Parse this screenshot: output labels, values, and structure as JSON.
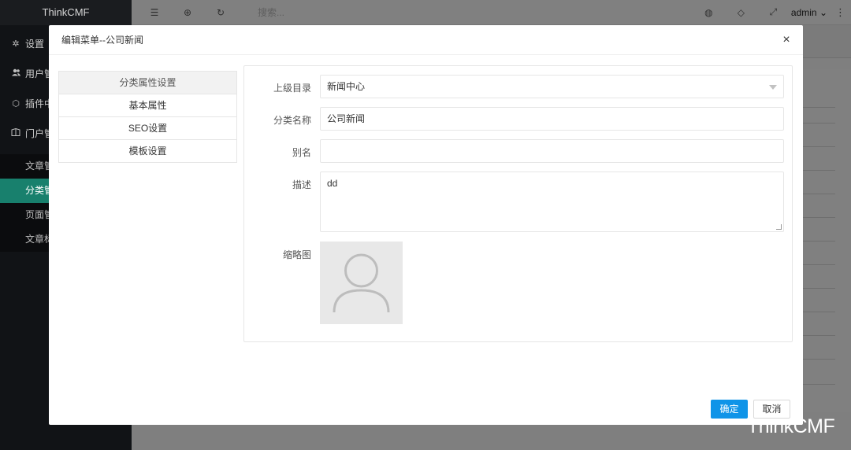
{
  "sidebar": {
    "logo": "ThinkCMF",
    "items": [
      {
        "icon": "gear-icon",
        "glyph": "✲",
        "label": "设置"
      },
      {
        "icon": "users-icon",
        "glyph": "👥",
        "label": "用户管"
      },
      {
        "icon": "plugin-icon",
        "glyph": "⬡",
        "label": "插件中"
      },
      {
        "icon": "portal-icon",
        "glyph": "⌂",
        "label": "门户管"
      }
    ],
    "subitems": [
      {
        "label": "文章管"
      },
      {
        "label": "分类管",
        "active": true
      },
      {
        "label": "页面管"
      },
      {
        "label": "文章标"
      }
    ]
  },
  "topbar": {
    "menu_icon": "☰",
    "globe_icon": "⊕",
    "refresh_icon": "↻",
    "search_placeholder": "搜索...",
    "theme_icon": "◍",
    "tag_icon": "◇",
    "fullscreen_icon": "⤢",
    "user": "admin",
    "user_chevron": "⌄",
    "more": "⋮"
  },
  "watermark": "ThinkCMF",
  "modal": {
    "title": "编辑菜单--公司新闻",
    "close": "×",
    "left_tabs": [
      "分类属性设置",
      "基本属性",
      "SEO设置",
      "模板设置"
    ],
    "form": {
      "parent_label": "上级目录",
      "parent_value": "新闻中心",
      "name_label": "分类名称",
      "name_value": "公司新闻",
      "alias_label": "别名",
      "alias_value": "",
      "desc_label": "描述",
      "desc_value": "dd",
      "thumb_label": "缩略图"
    },
    "ok_label": "确定",
    "cancel_label": "取消"
  },
  "colors": {
    "primary": "#0f94e8",
    "sidebar_active": "#18806d",
    "sidebar_bg": "#111316"
  }
}
